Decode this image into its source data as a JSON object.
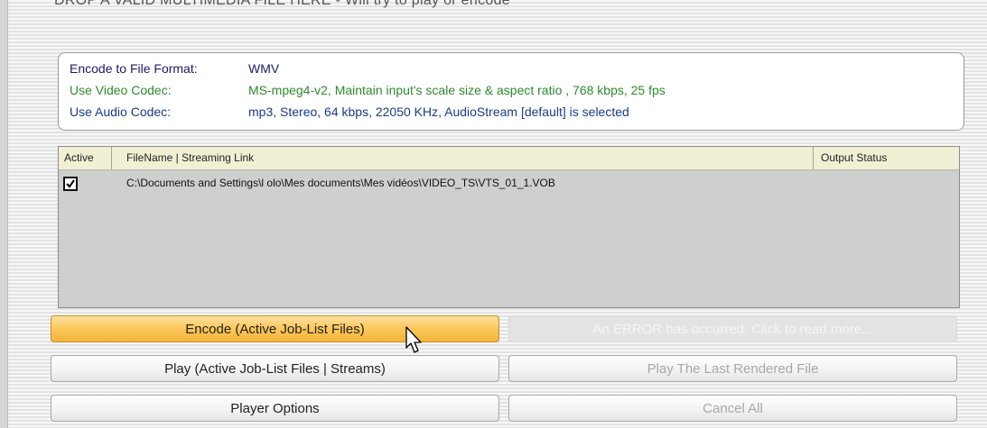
{
  "drop_hint": "DROP A VALID MULTIMEDIA FILE HERE - Will try to play or encode",
  "encode_info": {
    "format_label": "Encode to File Format:",
    "format_value": "WMV",
    "video_label": "Use Video Codec:",
    "video_value": "MS-mpeg4-v2,  Maintain input's scale size & aspect ratio ,  768 kbps,  25 fps",
    "audio_label": "Use Audio Codec:",
    "audio_value": "mp3,  Stereo,  64 kbps,  22050 KHz,  AudioStream [default] is selected"
  },
  "job_list": {
    "headers": {
      "active": "Active",
      "file": "FileName  |  Streaming Link",
      "status": "Output Status"
    },
    "rows": [
      {
        "active": true,
        "path": "C:\\Documents and Settings\\l  olo\\Mes documents\\Mes vidéos\\VIDEO_TS\\VTS_01_1.VOB",
        "status": ""
      }
    ]
  },
  "buttons": {
    "encode": "Encode (Active Job-List Files)",
    "error": "An ERROR has occurred. Click to read more...",
    "play": "Play (Active Job-List Files | Streams)",
    "play_last": "Play The Last Rendered File",
    "player_options": "Player Options",
    "cancel_all": "Cancel All"
  },
  "colors": {
    "video_codec_text": "#2d8a2d",
    "audio_codec_text": "#1a3a8a",
    "primary_button": "#fcc75a",
    "list_header_bg": "#f1f0d4",
    "list_bg": "#cfcfcf"
  },
  "icons": {
    "checkbox": "checkmark",
    "cursor": "arrow-pointer"
  }
}
